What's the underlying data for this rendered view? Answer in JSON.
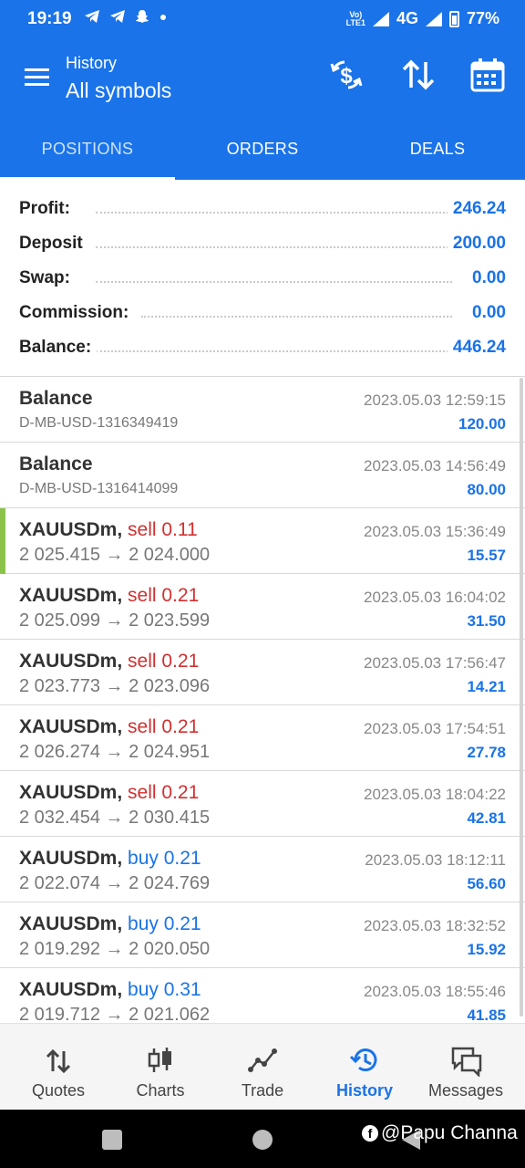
{
  "status_bar": {
    "time": "19:19",
    "notifications": [
      "telegram-icon",
      "telegram-icon",
      "snapchat-icon",
      "dot"
    ],
    "volte_top": "Vo)",
    "volte_bottom": "LTE1",
    "network": "4G",
    "battery": "77%"
  },
  "app_bar": {
    "subtitle": "History",
    "title": "All symbols",
    "actions": [
      "currency-exchange-icon",
      "sort-icon",
      "calendar-icon"
    ]
  },
  "tabs": [
    {
      "label": "POSITIONS",
      "active": true
    },
    {
      "label": "ORDERS",
      "active": false
    },
    {
      "label": "DEALS",
      "active": false
    }
  ],
  "summary": [
    {
      "label": "Profit:",
      "value": "246.24"
    },
    {
      "label": "Deposit",
      "value": "200.00"
    },
    {
      "label": "Swap:",
      "value": "0.00"
    },
    {
      "label": "Commission:",
      "value": "0.00"
    },
    {
      "label": "Balance:",
      "value": "446.24"
    }
  ],
  "deals": [
    {
      "symbol": "Balance",
      "side": "",
      "side_type": "",
      "sub": "D-MB-USD-1316349419",
      "time": "2023.05.03 12:59:15",
      "profit": "120.00"
    },
    {
      "symbol": "Balance",
      "side": "",
      "side_type": "",
      "sub": "D-MB-USD-1316414099",
      "time": "2023.05.03 14:56:49",
      "profit": "80.00"
    },
    {
      "symbol": "XAUUSDm,",
      "side": "sell 0.11",
      "side_type": "sell",
      "sub": "2 025.415 → 2 024.000",
      "time": "2023.05.03 15:36:49",
      "profit": "15.57"
    },
    {
      "symbol": "XAUUSDm,",
      "side": "sell 0.21",
      "side_type": "sell",
      "sub": "2 025.099 → 2 023.599",
      "time": "2023.05.03 16:04:02",
      "profit": "31.50"
    },
    {
      "symbol": "XAUUSDm,",
      "side": "sell 0.21",
      "side_type": "sell",
      "sub": "2 023.773 → 2 023.096",
      "time": "2023.05.03 17:56:47",
      "profit": "14.21"
    },
    {
      "symbol": "XAUUSDm,",
      "side": "sell 0.21",
      "side_type": "sell",
      "sub": "2 026.274 → 2 024.951",
      "time": "2023.05.03 17:54:51",
      "profit": "27.78"
    },
    {
      "symbol": "XAUUSDm,",
      "side": "sell 0.21",
      "side_type": "sell",
      "sub": "2 032.454 → 2 030.415",
      "time": "2023.05.03 18:04:22",
      "profit": "42.81"
    },
    {
      "symbol": "XAUUSDm,",
      "side": "buy 0.21",
      "side_type": "buy",
      "sub": "2 022.074 → 2 024.769",
      "time": "2023.05.03 18:12:11",
      "profit": "56.60"
    },
    {
      "symbol": "XAUUSDm,",
      "side": "buy 0.21",
      "side_type": "buy",
      "sub": "2 019.292 → 2 020.050",
      "time": "2023.05.03 18:32:52",
      "profit": "15.92"
    },
    {
      "symbol": "XAUUSDm,",
      "side": "buy 0.31",
      "side_type": "buy",
      "sub": "2 019.712 → 2 021.062",
      "time": "2023.05.03 18:55:46",
      "profit": "41.85"
    }
  ],
  "bottom_nav": [
    {
      "label": "Quotes",
      "icon": "quotes-icon",
      "active": false
    },
    {
      "label": "Charts",
      "icon": "charts-icon",
      "active": false
    },
    {
      "label": "Trade",
      "icon": "trade-icon",
      "active": false
    },
    {
      "label": "History",
      "icon": "history-icon",
      "active": true
    },
    {
      "label": "Messages",
      "icon": "messages-icon",
      "active": false
    }
  ],
  "watermark": "@Papu Channa",
  "colors": {
    "primary": "#1a73e8",
    "sell": "#d32f2f",
    "buy": "#1a73e8",
    "marker": "#8bc34a"
  }
}
